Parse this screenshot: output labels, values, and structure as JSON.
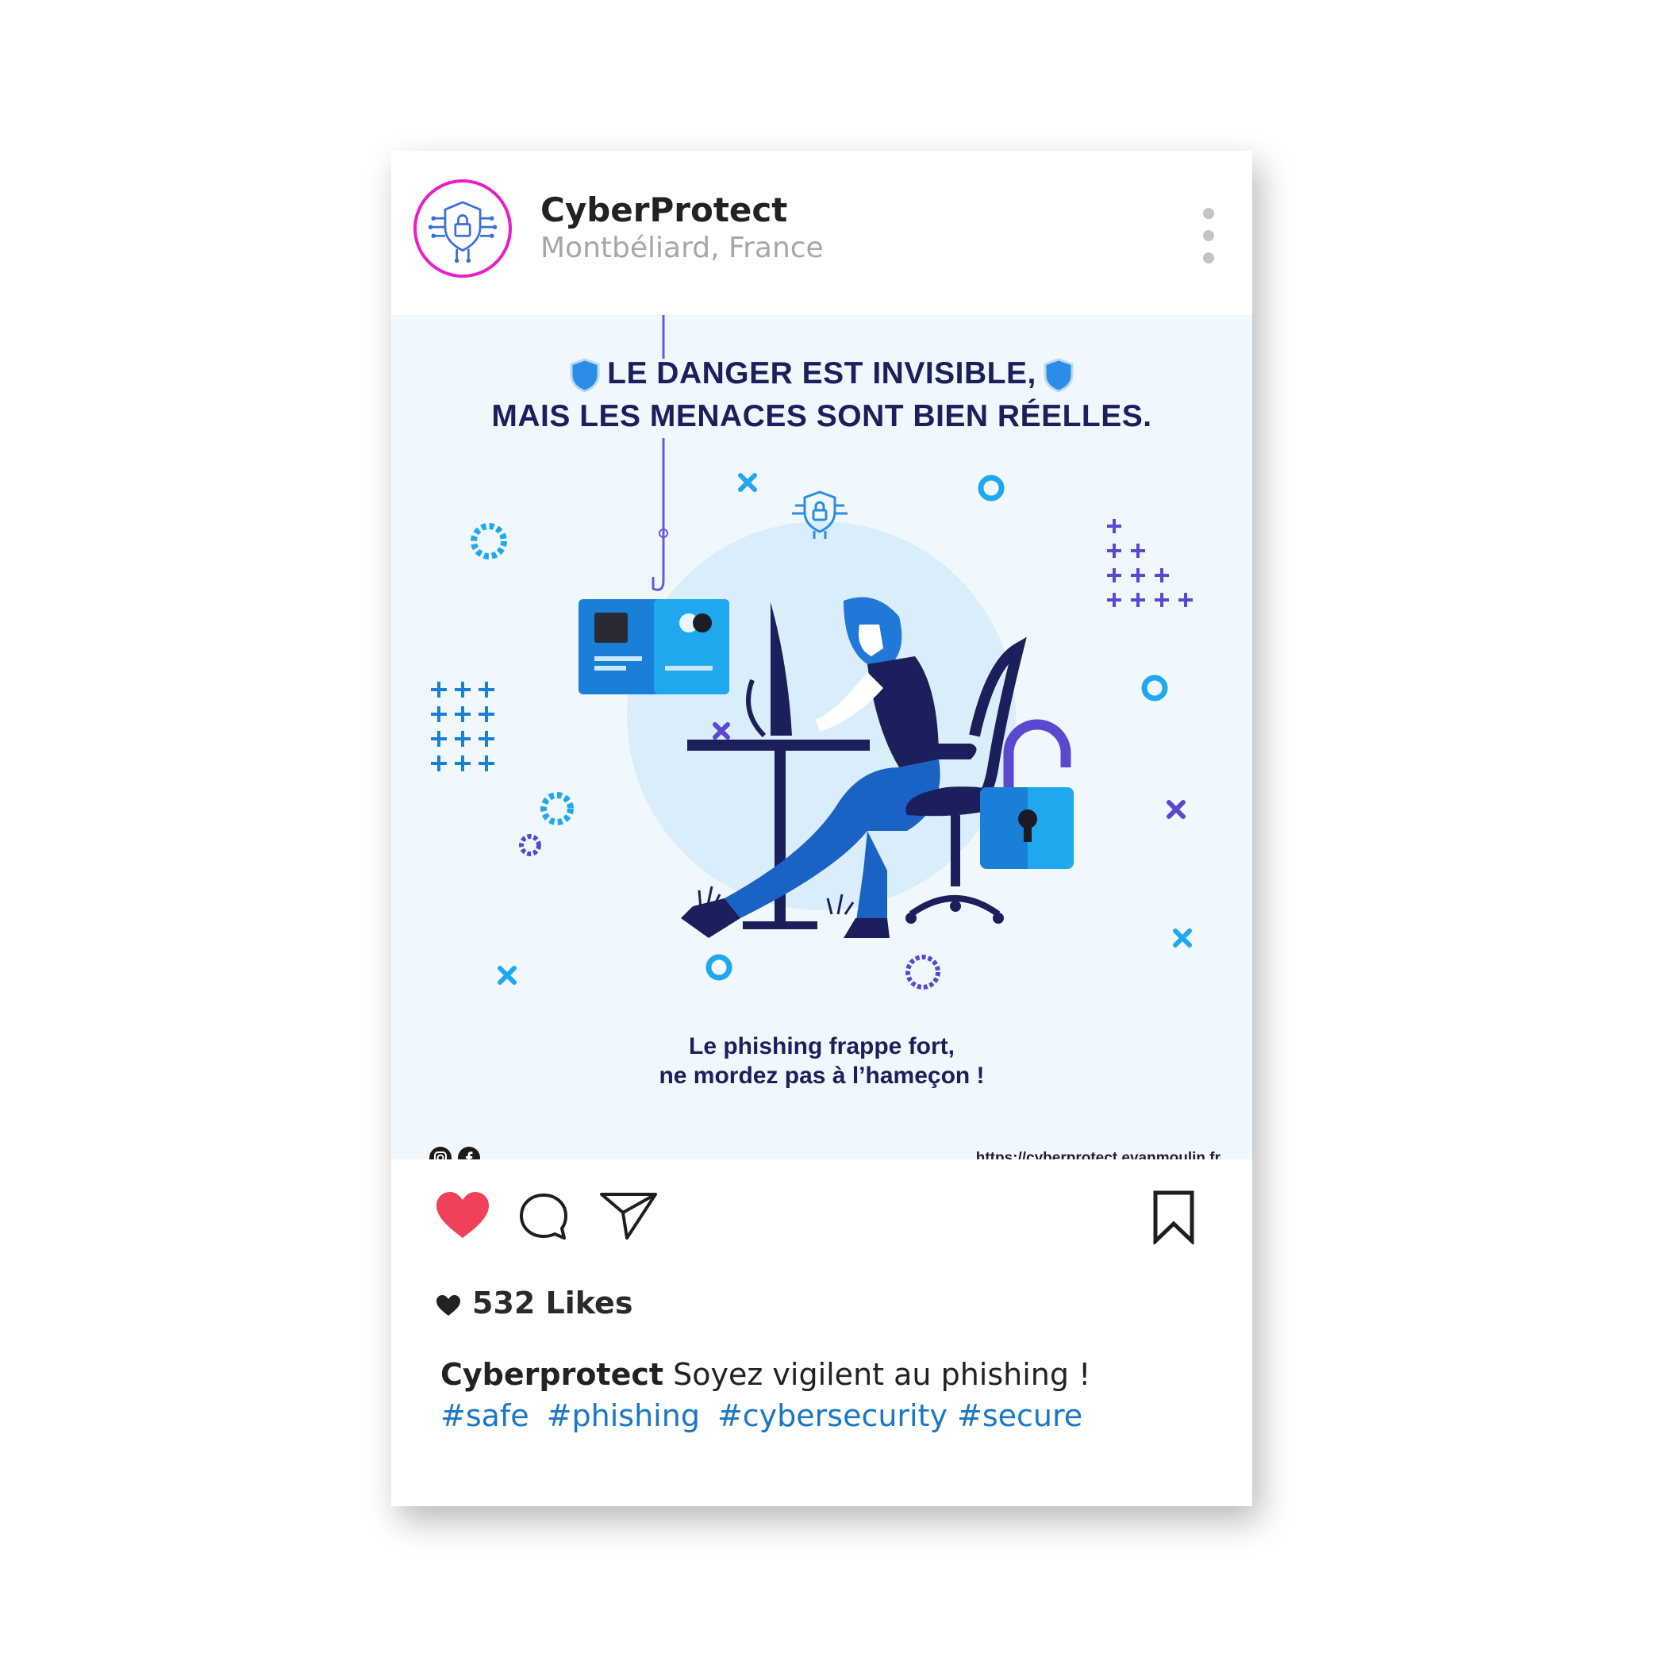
{
  "post": {
    "account_name": "CyberProtect",
    "location": "Montbéliard, France",
    "image": {
      "headline_line1": "LE DANGER EST INVISIBLE,",
      "headline_line2": "MAIS LES MENACES SONT BIEN RÉELLES.",
      "tagline_line1": "Le phishing frappe fort,",
      "tagline_line2": "ne mordez pas à l’hameçon !",
      "website": "https://cyberprotect.evanmoulin.fr"
    },
    "likes_text": "532 Likes",
    "caption_user": "Cyberprotect",
    "caption_text": " Soyez vigilent au phishing !",
    "hashtags": [
      "#safe",
      "#phishing",
      "#cybersecurity",
      "#secure"
    ]
  },
  "colors": {
    "avatar_ring": "#e91ec7",
    "heart": "#f0415a",
    "hashtag": "#1976c8",
    "headline": "#1b1f5c",
    "post_bg": "#f1f8fd"
  },
  "icons": [
    "shield-circuit-logo",
    "more-options-icon",
    "heart-icon",
    "comment-icon",
    "share-icon",
    "bookmark-icon",
    "instagram-icon",
    "facebook-icon"
  ]
}
